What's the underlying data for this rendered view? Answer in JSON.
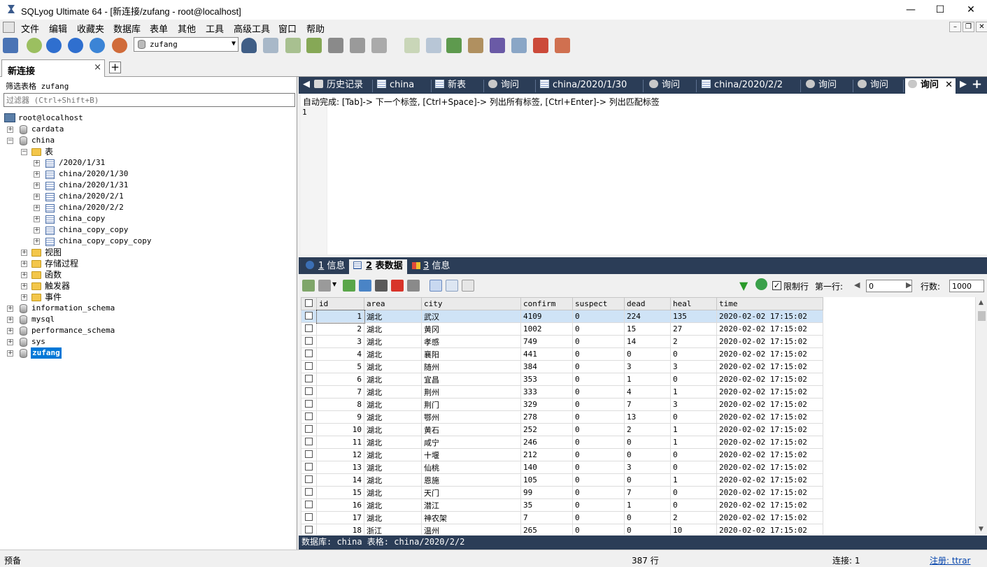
{
  "window": {
    "title": "SQLyog Ultimate 64 - [新连接/zufang - root@localhost]"
  },
  "menu": [
    "文件",
    "编辑",
    "收藏夹",
    "数据库",
    "表单",
    "其他",
    "工具",
    "高级工具",
    "窗口",
    "帮助"
  ],
  "toolbar": {
    "database_selected": "zufang"
  },
  "connection_tab": {
    "label": "新连接",
    "close": "×",
    "add": "+"
  },
  "left": {
    "filter_label": "筛选表格 zufang",
    "filter_placeholder": "过滤器 (Ctrl+Shift+B)",
    "server": "root@localhost",
    "databases": [
      "cardata",
      "china",
      "information_schema",
      "mysql",
      "performance_schema",
      "sys",
      "zufang"
    ],
    "china_tables_folder": "表",
    "china_tables": [
      "/2020/1/31",
      "china/2020/1/30",
      "china/2020/1/31",
      "china/2020/2/1",
      "china/2020/2/2",
      "china_copy",
      "china_copy_copy",
      "china_copy_copy_copy"
    ],
    "china_folders": [
      "视图",
      "存储过程",
      "函数",
      "触发器",
      "事件"
    ]
  },
  "query_tabs": [
    "历史记录",
    "china",
    "新表",
    "询问",
    "china/2020/1/30",
    "询问",
    "china/2020/2/2",
    "询问",
    "询问",
    "询问"
  ],
  "editor": {
    "autocomplete_hint": "自动完成: [Tab]-> 下一个标签, [Ctrl+Space]-> 列出所有标签, [Ctrl+Enter]-> 列出匹配标签",
    "line_number": "1"
  },
  "result_tabs": [
    {
      "num": "1",
      "label": "信息"
    },
    {
      "num": "2",
      "label": "表数据"
    },
    {
      "num": "3",
      "label": "信息"
    }
  ],
  "grid_toolbar": {
    "limit_label": "限制行",
    "first_row_label": "第一行:",
    "first_row_value": "0",
    "rows_label": "行数:",
    "rows_value": "1000"
  },
  "grid": {
    "columns": [
      "id",
      "area",
      "city",
      "confirm",
      "suspect",
      "dead",
      "heal",
      "time"
    ],
    "rows": [
      [
        "1",
        "湖北",
        "武汉",
        "4109",
        "0",
        "224",
        "135",
        "2020-02-02 17:15:02"
      ],
      [
        "2",
        "湖北",
        "黄冈",
        "1002",
        "0",
        "15",
        "27",
        "2020-02-02 17:15:02"
      ],
      [
        "3",
        "湖北",
        "孝感",
        "749",
        "0",
        "14",
        "2",
        "2020-02-02 17:15:02"
      ],
      [
        "4",
        "湖北",
        "襄阳",
        "441",
        "0",
        "0",
        "0",
        "2020-02-02 17:15:02"
      ],
      [
        "5",
        "湖北",
        "随州",
        "384",
        "0",
        "3",
        "3",
        "2020-02-02 17:15:02"
      ],
      [
        "6",
        "湖北",
        "宜昌",
        "353",
        "0",
        "1",
        "0",
        "2020-02-02 17:15:02"
      ],
      [
        "7",
        "湖北",
        "荆州",
        "333",
        "0",
        "4",
        "1",
        "2020-02-02 17:15:02"
      ],
      [
        "8",
        "湖北",
        "荆门",
        "329",
        "0",
        "7",
        "3",
        "2020-02-02 17:15:02"
      ],
      [
        "9",
        "湖北",
        "鄂州",
        "278",
        "0",
        "13",
        "0",
        "2020-02-02 17:15:02"
      ],
      [
        "10",
        "湖北",
        "黄石",
        "252",
        "0",
        "2",
        "1",
        "2020-02-02 17:15:02"
      ],
      [
        "11",
        "湖北",
        "咸宁",
        "246",
        "0",
        "0",
        "1",
        "2020-02-02 17:15:02"
      ],
      [
        "12",
        "湖北",
        "十堰",
        "212",
        "0",
        "0",
        "0",
        "2020-02-02 17:15:02"
      ],
      [
        "13",
        "湖北",
        "仙桃",
        "140",
        "0",
        "3",
        "0",
        "2020-02-02 17:15:02"
      ],
      [
        "14",
        "湖北",
        "恩施",
        "105",
        "0",
        "0",
        "1",
        "2020-02-02 17:15:02"
      ],
      [
        "15",
        "湖北",
        "天门",
        "99",
        "0",
        "7",
        "0",
        "2020-02-02 17:15:02"
      ],
      [
        "16",
        "湖北",
        "潜江",
        "35",
        "0",
        "1",
        "0",
        "2020-02-02 17:15:02"
      ],
      [
        "17",
        "湖北",
        "神农架",
        "7",
        "0",
        "0",
        "2",
        "2020-02-02 17:15:02"
      ],
      [
        "18",
        "浙江",
        "温州",
        "265",
        "0",
        "0",
        "10",
        "2020-02-02 17:15:02"
      ]
    ]
  },
  "pane_footer": "数据库: china 表格: china/2020/2/2",
  "status": {
    "left": "预备",
    "rows": "387 行",
    "connections": "连接: 1",
    "register": "注册: ttrar"
  },
  "colors": {
    "accent": "#0078d7",
    "tab_bar": "#2b3d57",
    "selected_row": "#cfe3f6"
  }
}
